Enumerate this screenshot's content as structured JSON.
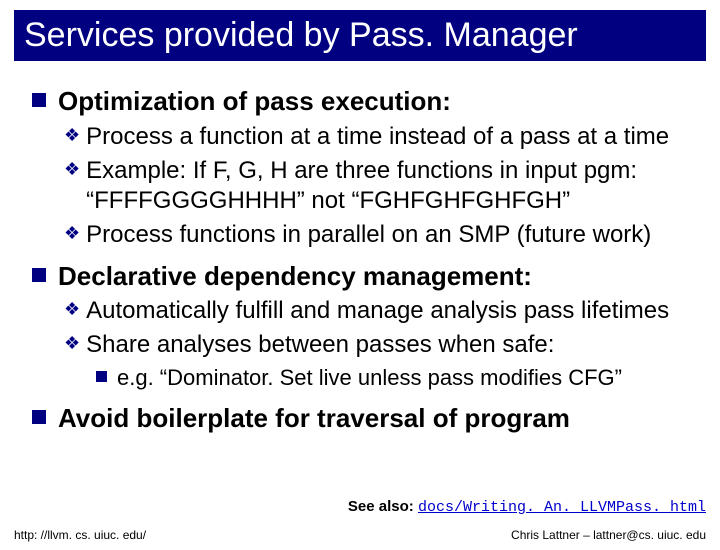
{
  "title": "Services provided by Pass. Manager",
  "b1": {
    "h": "Optimization of pass execution:",
    "i1": "Process a function at a time instead of a pass at a time",
    "i2": "Example: If F, G, H are three functions in input pgm: “FFFFGGGGHHHH” not “FGHFGHFGHFGH”",
    "i3": "Process functions in parallel on an SMP (future work)"
  },
  "b2": {
    "h": "Declarative dependency management:",
    "i1": "Automatically fulfill and manage analysis pass lifetimes",
    "i2": "Share analyses between passes when safe:",
    "i2a": "e.g. “Dominator. Set live unless pass modifies CFG”"
  },
  "b3": {
    "h": "Avoid boilerplate for traversal of program"
  },
  "seealso_label": "See also: ",
  "seealso_link": "docs/Writing. An. LLVMPass. html",
  "footer_left": "http: //llvm. cs. uiuc. edu/",
  "footer_right": "Chris Lattner – lattner@cs. uiuc. edu"
}
